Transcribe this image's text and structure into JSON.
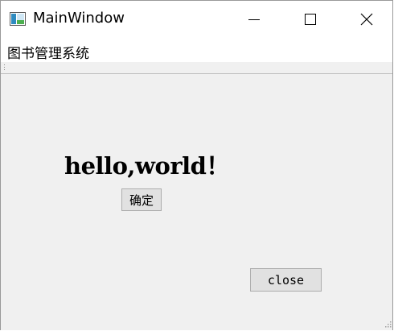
{
  "window": {
    "title": "MainWindow"
  },
  "titlebar_icons": {
    "app": "app-window-icon",
    "minimize": "minimize-icon",
    "maximize": "maximize-icon",
    "close": "close-icon"
  },
  "menubar": {
    "items": [
      {
        "label": "图书管理系统"
      }
    ]
  },
  "central": {
    "greeting": "hello,world！",
    "ok_button": "确定",
    "close_button": "close"
  },
  "colors": {
    "window_bg": "#f0f0f0",
    "titlebar_bg": "#ffffff",
    "button_bg": "#e1e1e1",
    "button_border": "#adadad"
  }
}
